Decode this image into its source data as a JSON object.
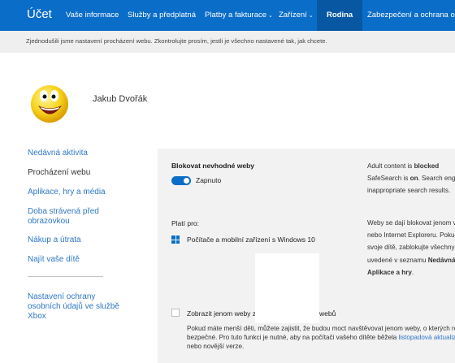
{
  "nav": {
    "brand": "Účet",
    "items": [
      {
        "label": "Vaše informace"
      },
      {
        "label": "Služby a předplatná"
      },
      {
        "label": "Platby a fakturace",
        "caret": "⌄"
      },
      {
        "label": "Zařízení",
        "caret": "⌄"
      },
      {
        "label": "Rodina"
      },
      {
        "label": "Zabezpečení a ochrana osobn"
      }
    ]
  },
  "banner": {
    "text": "Zjednodušili jsme nastavení procházení webu. Zkontrolujte prosím, jestli je všechno nastavené tak, jak chcete."
  },
  "profile": {
    "name": "Jakub Dvořák"
  },
  "sidebar": {
    "items": [
      {
        "label": "Nedávná aktivita"
      },
      {
        "label": "Procházení webu"
      },
      {
        "label": "Aplikace, hry a média"
      },
      {
        "label": "Doba strávená před obrazovkou"
      },
      {
        "label": "Nákup a útrata"
      },
      {
        "label": "Najít vaše dítě"
      },
      {
        "label": "Nastavení ochrany osobních údajů ve službě Xbox"
      }
    ]
  },
  "panel": {
    "block_title": "Blokovat nevhodné weby",
    "toggle_state": "Zapnuto",
    "applies_title": "Platí pro:",
    "device": "Počítače a mobilní zařízení s Windows 10",
    "checkbox_label_start": "Zobrazit jenom weby ze",
    "checkbox_label_end": "webů",
    "note_line1": "Pokud máte menší děti, můžete zajistit, že budou moct navštěvovat jenom weby, o kterých ro",
    "note_line2a": "bezpečné. Pro tuto funkci je nutné, aby na počítači vašeho dítěte běžela",
    "note_line2_link": "listopadová aktualiz",
    "note_line3": "nebo novější verze."
  },
  "right": {
    "l1_a": "Adult content is",
    "l1_b": "blocked",
    "l2_a": "SafeSearch is",
    "l2_b": "on",
    "l2_c": ". Search engin",
    "l3": "inappropriate search results.",
    "w1": "Weby se dají blokovat jenom v",
    "w2": "nebo Internet Exploreru. Pokuc",
    "w3": "svoje dítě, zablokujte všechny",
    "w4_a": "uvedené v seznamu",
    "w4_b": "Nedávná",
    "w5_a": "Aplikace a hry",
    "w5_b": "."
  },
  "colors": {
    "accent": "#0a6dc8",
    "active_nav": "#0857a3",
    "link": "#2f77c6"
  }
}
